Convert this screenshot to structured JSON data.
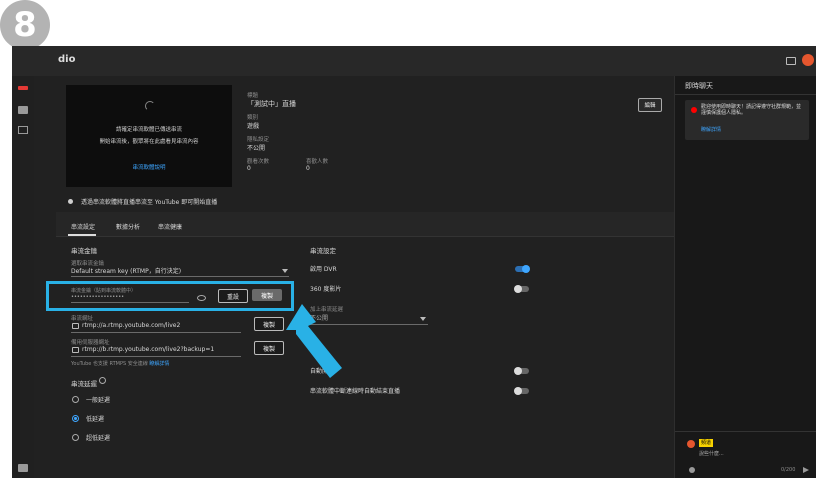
{
  "step_number": "8",
  "app": {
    "title": "dio"
  },
  "preview": {
    "line1": "請確定串流軟體已傳送串流",
    "line2": "開始串流後，觀眾將在此處看見串流內容",
    "link": "串流軟體說明"
  },
  "edit_button": "編輯",
  "info": {
    "title_label": "標題",
    "title": "「測試中」直播",
    "category_label": "類別",
    "category": "遊戲",
    "privacy_label": "隱私設定",
    "privacy": "不公開",
    "viewers_label": "觀看次數",
    "viewers": "0",
    "likes_label": "喜歡人數",
    "likes": "0"
  },
  "notice": "透過串流軟體將直播串流至 YouTube 即可開始直播",
  "tabs": [
    "串流設定",
    "數據分析",
    "串流健康"
  ],
  "stream_key": {
    "section_title": "串流金鑰",
    "select_label": "選取串流金鑰",
    "select_value": "Default stream key (RTMP，自行決定)",
    "key_label": "串流金鑰（貼到串流軟體中）",
    "key_value": "••••••••••••••••••",
    "reset_button": "重設",
    "copy_button": "複製",
    "url_label": "串流網址",
    "url_value": "rtmp://a.rtmp.youtube.com/live2",
    "backup_label": "備用伺服器網址",
    "backup_value": "rtmp://b.rtmp.youtube.com/live2?backup=1",
    "hint": "YouTube 也支援 RTMPS 安全連線",
    "hint_link": "瞭解詳情",
    "url_copy": "複製",
    "backup_copy": "複製"
  },
  "latency": {
    "title": "串流延遲",
    "options": [
      "一般延遲",
      "低延遲",
      "超低延遲"
    ],
    "selected_index": 1
  },
  "settings": {
    "title": "串流設定",
    "dvr": "啟用 DVR",
    "dvr_on": true,
    "vr360": "360 度影片",
    "vr360_on": false,
    "delay_label": "加上串流延遲",
    "unlisted": "不公開",
    "auto_start": "自動開始",
    "auto_start_on": false,
    "auto_stop": "串流軟體中斷連線時自動結束直播",
    "auto_stop_on": false
  },
  "chat": {
    "title": "即時聊天",
    "message": "歡迎使用即時聊天！請記得遵守社群規範，並謹慎保護個人隱私。",
    "link": "瞭解詳情",
    "user_badge": "頻道",
    "user_text": "說些什麼...",
    "count": "0/200"
  },
  "colors": {
    "accent": "#3ea6ff",
    "highlight": "#29b1e6",
    "youtube_red": "#ff0000"
  }
}
